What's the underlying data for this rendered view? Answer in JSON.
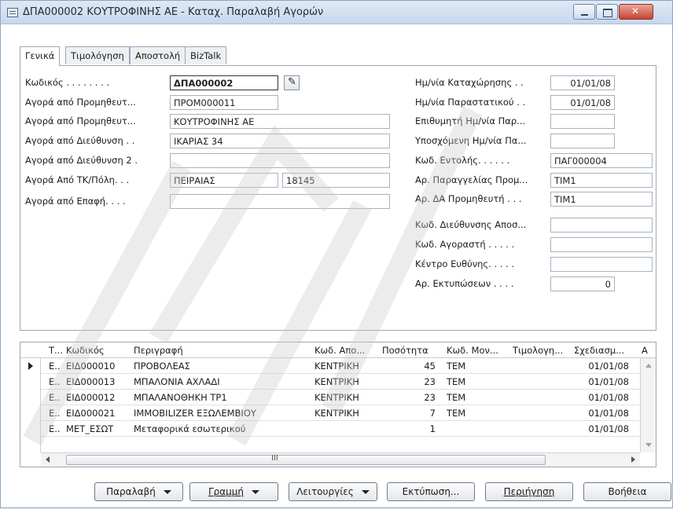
{
  "window": {
    "title": "ΔΠΑ000002 ΚΟΥΤΡΟΦΙΝΗΣ ΑΕ - Καταχ. Παραλαβή Αγορών",
    "icon": "form-icon"
  },
  "tabs": [
    {
      "label": "Γενικά",
      "active": true
    },
    {
      "label": "Τιμολόγηση",
      "active": false
    },
    {
      "label": "Αποστολή",
      "active": false
    },
    {
      "label": "BizTalk",
      "active": false
    }
  ],
  "left_fields": [
    {
      "label": "Κωδικός . . . . . . . .",
      "value": "ΔΠΑ000002"
    },
    {
      "label": "Αγορά από Προμηθευτ...",
      "value": "ΠΡΟΜ000011"
    },
    {
      "label": "Αγορά από Προμηθευτ...",
      "value": "ΚΟΥΤΡΟΦΙΝΗΣ ΑΕ"
    },
    {
      "label": "Αγορά από Διεύθυνση . .",
      "value": "ΙΚΑΡΙΑΣ 34"
    },
    {
      "label": "Αγορά από Διεύθυνση 2 .",
      "value": ""
    },
    {
      "label": "Αγορά Από ΤΚ/Πόλη. . .",
      "value": "ΠΕΙΡΑΙΑΣ",
      "value2": "18145"
    },
    {
      "label": "Αγορά από Επαφή. . . .",
      "value": ""
    }
  ],
  "right_fields": [
    {
      "label": "Ημ/νία Καταχώρησης . .",
      "value": "01/01/08"
    },
    {
      "label": "Ημ/νία Παραστατικού . .",
      "value": "01/01/08"
    },
    {
      "label": "Επιθυμητή Ημ/νία Παρ...",
      "value": ""
    },
    {
      "label": "Υποσχόμενη Ημ/νία Πα...",
      "value": ""
    },
    {
      "label": "Κωδ. Εντολής. . . . . .",
      "value": "ΠΑΓ000004"
    },
    {
      "label": "Αρ. Παραγγελίας Προμ...",
      "value": "ΤΙΜ1"
    },
    {
      "label": "Αρ. ΔΑ Προμηθευτή . . .",
      "value": "ΤΙΜ1"
    },
    {
      "label": "Κωδ. Διεύθυνσης Αποσ...",
      "value": ""
    },
    {
      "label": "Κωδ. Αγοραστή . . . . .",
      "value": ""
    },
    {
      "label": "Κέντρο Ευθύνης. . . . .",
      "value": ""
    },
    {
      "label": "Αρ. Εκτυπώσεων . . . .",
      "value": "0"
    }
  ],
  "lines": {
    "headers": [
      "Τ...",
      "Κωδικός",
      "Περιγραφή",
      "Κωδ. Απο...",
      "Ποσότητα",
      "Κωδ. Μον...",
      "Τιμολογη...",
      "Σχεδιασμ...",
      "Α"
    ],
    "rows": [
      {
        "type": "Ε..",
        "code": "ΕΙΔ000010",
        "desc": "ΠΡΟΒΟΛΕΑΣ",
        "location": "ΚΕΝΤΡΙΚΗ",
        "qty": "45",
        "uom": "ΤΕΜ",
        "date": "01/01/08",
        "current": true
      },
      {
        "type": "Ε..",
        "code": "ΕΙΔ000013",
        "desc": "ΜΠΑΛΟΝΙΑ ΑΧΛΑΔΙ",
        "location": "ΚΕΝΤΡΙΚΗ",
        "qty": "23",
        "uom": "ΤΕΜ",
        "date": "01/01/08",
        "current": false
      },
      {
        "type": "Ε..",
        "code": "ΕΙΔ000012",
        "desc": "ΜΠΑΛΑΝΟΘΗΚΗ ΤΡ1",
        "location": "ΚΕΝΤΡΙΚΗ",
        "qty": "23",
        "uom": "ΤΕΜ",
        "date": "01/01/08",
        "current": false
      },
      {
        "type": "Ε..",
        "code": "ΕΙΔ000021",
        "desc": "IMMOBILIZER ΕΞΩΛΕΜΒΙΟΥ",
        "location": "ΚΕΝΤΡΙΚΗ",
        "qty": "7",
        "uom": "ΤΕΜ",
        "date": "01/01/08",
        "current": false
      },
      {
        "type": "Ε..",
        "code": "ΜΕΤ_ΕΣΩΤ",
        "desc": "Μεταφορικά εσωτερικού",
        "location": "",
        "qty": "1",
        "uom": "",
        "date": "01/01/08",
        "current": false
      }
    ],
    "scroll_grip": "III"
  },
  "buttons": {
    "receive": "Παραλαβή",
    "line": "Γραμμή",
    "functions": "Λειτουργίες",
    "print": "Εκτύπωση...",
    "navigate": "Περιήγηση",
    "help": "Βοήθεια"
  },
  "colors": {
    "titlebar": "#c7d8ee",
    "border": "#9aa8b6",
    "close_button": "#c8442f"
  }
}
